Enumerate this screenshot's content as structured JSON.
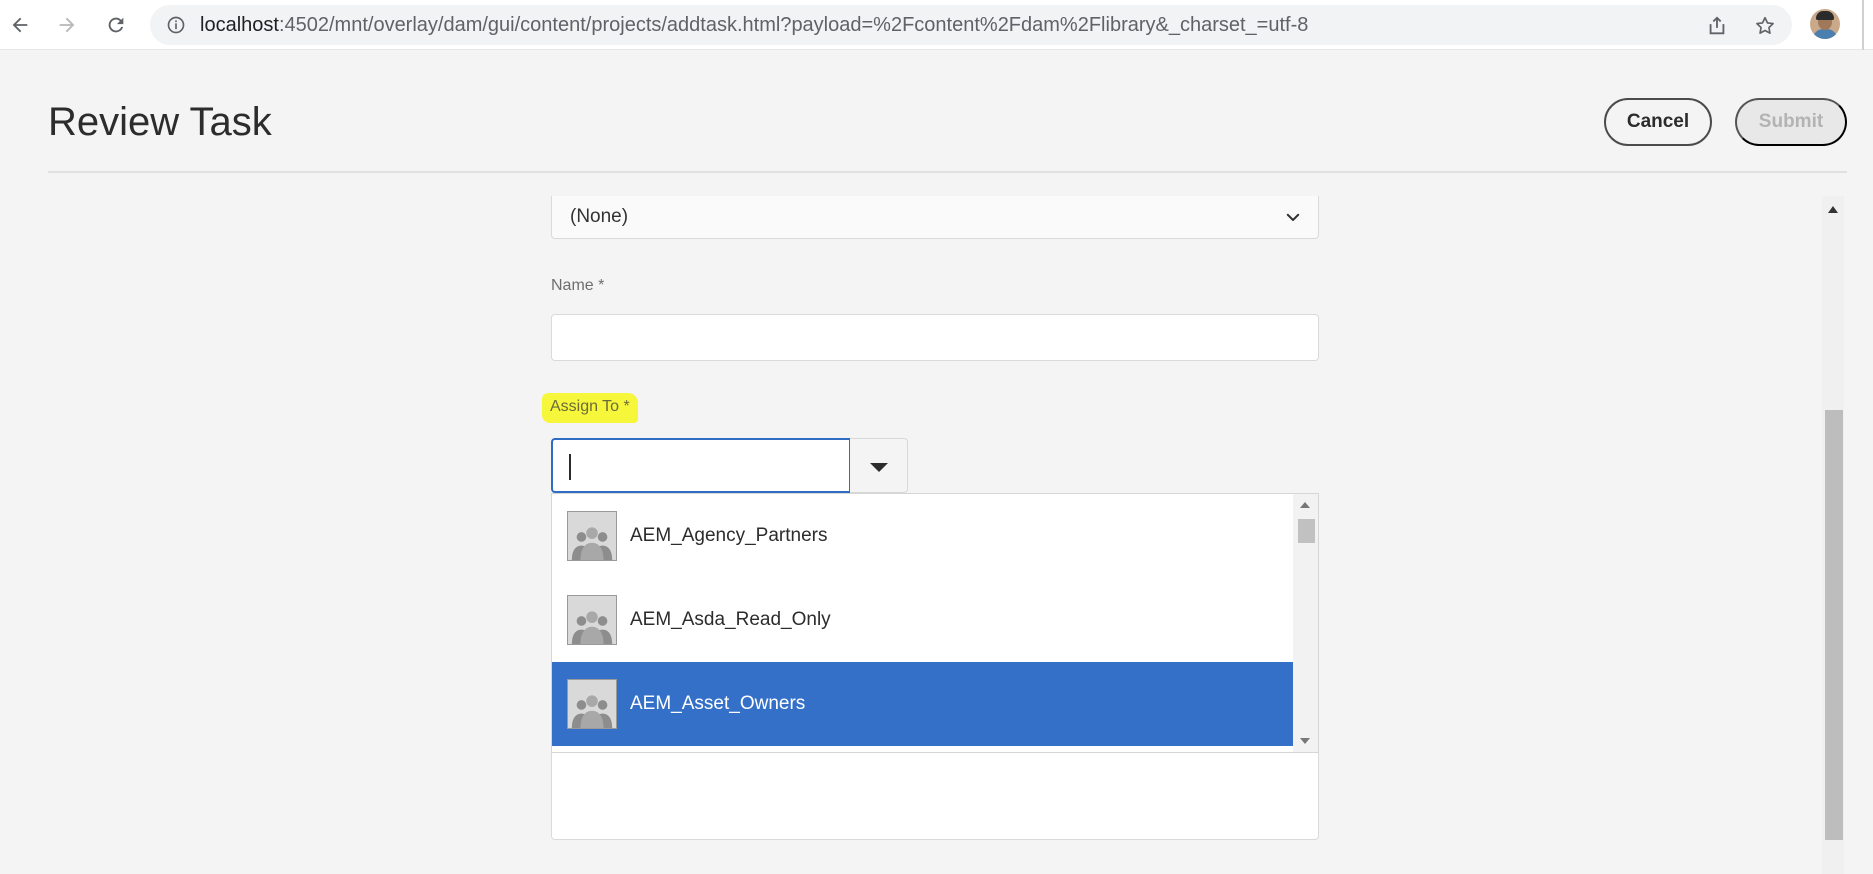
{
  "browser": {
    "url_host": "localhost",
    "url_rest": ":4502/mnt/overlay/dam/gui/content/projects/addtask.html?payload=%2Fcontent%2Fdam%2Flibrary&_charset_=utf-8",
    "icons": [
      "back-arrow-icon",
      "forward-arrow-icon",
      "reload-icon",
      "site-info-icon",
      "share-icon",
      "bookmark-star-icon",
      "profile-avatar"
    ]
  },
  "header": {
    "title": "Review Task",
    "cancel_label": "Cancel",
    "submit_label": "Submit"
  },
  "form": {
    "template_select_value": "(None)",
    "name_label": "Name *",
    "name_value": "",
    "assign_label": "Assign To *",
    "assign_value": "",
    "assign_options": [
      {
        "label": "AEM_Agency_Partners",
        "selected": false
      },
      {
        "label": "AEM_Asda_Read_Only",
        "selected": false
      },
      {
        "label": "AEM_Asset_Owners",
        "selected": true
      }
    ]
  },
  "colors": {
    "highlight": "#f6f63a",
    "selected_option": "#3470c8",
    "focus_border": "#2f6cc4"
  }
}
